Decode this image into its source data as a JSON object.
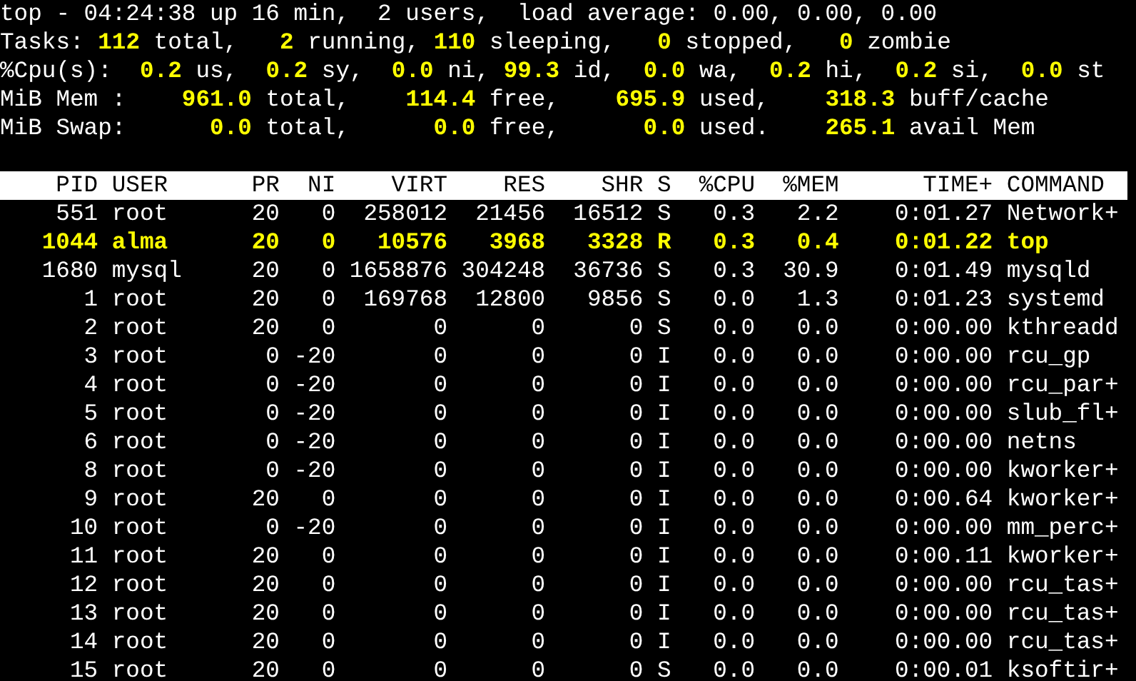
{
  "summary": [
    "top - 04:24:38 up 16 min,  2 users,  load average: 0.00, 0.00, 0.00",
    "Tasks: **112** total,   **2** running, **110** sleeping,   **0** stopped,   **0** zombie",
    "%Cpu(s):  **0.2** us,  **0.2** sy,  **0.0** ni, **99.3** id,  **0.0** wa,  **0.2** hi,  **0.2** si,  **0.0** st",
    "MiB Mem :    **961.0** total,    **114.4** free,    **695.9** used,    **318.3** buff/cache",
    "MiB Swap:      **0.0** total,      **0.0** free,      **0.0** used.    **265.1** avail Mem"
  ],
  "table": {
    "columns": [
      "PID",
      "USER",
      "PR",
      "NI",
      "VIRT",
      "RES",
      "SHR",
      "S",
      "%CPU",
      "%MEM",
      "TIME+",
      "COMMAND"
    ],
    "rows": [
      {
        "cells": [
          "551",
          "root",
          "20",
          "0",
          "258012",
          "21456",
          "16512",
          "S",
          "0.3",
          "2.2",
          "0:01.27",
          "Network+"
        ],
        "highlighted": false
      },
      {
        "cells": [
          "1044",
          "alma",
          "20",
          "0",
          "10576",
          "3968",
          "3328",
          "R",
          "0.3",
          "0.4",
          "0:01.22",
          "top"
        ],
        "highlighted": true
      },
      {
        "cells": [
          "1680",
          "mysql",
          "20",
          "0",
          "1658876",
          "304248",
          "36736",
          "S",
          "0.3",
          "30.9",
          "0:01.49",
          "mysqld"
        ],
        "highlighted": false
      },
      {
        "cells": [
          "1",
          "root",
          "20",
          "0",
          "169768",
          "12800",
          "9856",
          "S",
          "0.0",
          "1.3",
          "0:01.23",
          "systemd"
        ],
        "highlighted": false
      },
      {
        "cells": [
          "2",
          "root",
          "20",
          "0",
          "0",
          "0",
          "0",
          "S",
          "0.0",
          "0.0",
          "0:00.00",
          "kthreadd"
        ],
        "highlighted": false
      },
      {
        "cells": [
          "3",
          "root",
          "0",
          "-20",
          "0",
          "0",
          "0",
          "I",
          "0.0",
          "0.0",
          "0:00.00",
          "rcu_gp"
        ],
        "highlighted": false
      },
      {
        "cells": [
          "4",
          "root",
          "0",
          "-20",
          "0",
          "0",
          "0",
          "I",
          "0.0",
          "0.0",
          "0:00.00",
          "rcu_par+"
        ],
        "highlighted": false
      },
      {
        "cells": [
          "5",
          "root",
          "0",
          "-20",
          "0",
          "0",
          "0",
          "I",
          "0.0",
          "0.0",
          "0:00.00",
          "slub_fl+"
        ],
        "highlighted": false
      },
      {
        "cells": [
          "6",
          "root",
          "0",
          "-20",
          "0",
          "0",
          "0",
          "I",
          "0.0",
          "0.0",
          "0:00.00",
          "netns"
        ],
        "highlighted": false
      },
      {
        "cells": [
          "8",
          "root",
          "0",
          "-20",
          "0",
          "0",
          "0",
          "I",
          "0.0",
          "0.0",
          "0:00.00",
          "kworker+"
        ],
        "highlighted": false
      },
      {
        "cells": [
          "9",
          "root",
          "20",
          "0",
          "0",
          "0",
          "0",
          "I",
          "0.0",
          "0.0",
          "0:00.64",
          "kworker+"
        ],
        "highlighted": false
      },
      {
        "cells": [
          "10",
          "root",
          "0",
          "-20",
          "0",
          "0",
          "0",
          "I",
          "0.0",
          "0.0",
          "0:00.00",
          "mm_perc+"
        ],
        "highlighted": false
      },
      {
        "cells": [
          "11",
          "root",
          "20",
          "0",
          "0",
          "0",
          "0",
          "I",
          "0.0",
          "0.0",
          "0:00.11",
          "kworker+"
        ],
        "highlighted": false
      },
      {
        "cells": [
          "12",
          "root",
          "20",
          "0",
          "0",
          "0",
          "0",
          "I",
          "0.0",
          "0.0",
          "0:00.00",
          "rcu_tas+"
        ],
        "highlighted": false
      },
      {
        "cells": [
          "13",
          "root",
          "20",
          "0",
          "0",
          "0",
          "0",
          "I",
          "0.0",
          "0.0",
          "0:00.00",
          "rcu_tas+"
        ],
        "highlighted": false
      },
      {
        "cells": [
          "14",
          "root",
          "20",
          "0",
          "0",
          "0",
          "0",
          "I",
          "0.0",
          "0.0",
          "0:00.00",
          "rcu_tas+"
        ],
        "highlighted": false
      },
      {
        "cells": [
          "15",
          "root",
          "20",
          "0",
          "0",
          "0",
          "0",
          "S",
          "0.0",
          "0.0",
          "0:00.01",
          "ksoftir+"
        ],
        "highlighted": false
      }
    ]
  }
}
